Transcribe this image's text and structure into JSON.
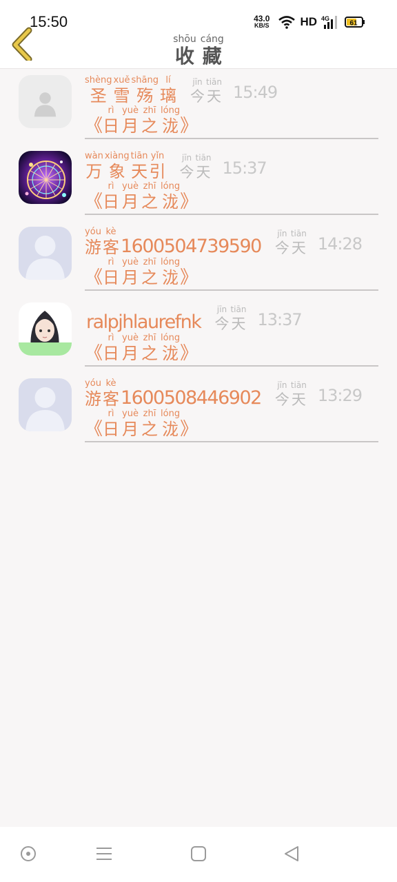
{
  "status": {
    "time": "15:50",
    "net_speed_value": "43.0",
    "net_speed_unit": "KB/S",
    "hd": "HD",
    "network": "4G",
    "battery": "61"
  },
  "header": {
    "title_chars": [
      {
        "py": "shōu",
        "hz": "收"
      },
      {
        "py": "cáng",
        "hz": "藏"
      }
    ]
  },
  "items": [
    {
      "avatar": "default-person-gray",
      "name_chars": [
        {
          "py": "shèng",
          "hz": "圣"
        },
        {
          "py": "xuě",
          "hz": "雪"
        },
        {
          "py": "shāng",
          "hz": "殇"
        },
        {
          "py": "lí",
          "hz": "璃"
        }
      ],
      "name_tail": "",
      "day": [
        {
          "py": "jīn",
          "hz": "今"
        },
        {
          "py": "tiān",
          "hz": "天"
        }
      ],
      "time": "15:49",
      "book_chars": [
        {
          "py": "rì",
          "hz": "日"
        },
        {
          "py": "yuè",
          "hz": "月"
        },
        {
          "py": "zhī",
          "hz": "之"
        },
        {
          "py": "lóng",
          "hz": "泷"
        }
      ]
    },
    {
      "avatar": "ferris-wheel-photo",
      "name_chars": [
        {
          "py": "wàn",
          "hz": "万"
        },
        {
          "py": "xiàng",
          "hz": "象"
        },
        {
          "py": "tiān",
          "hz": "天"
        },
        {
          "py": "yǐn",
          "hz": "引"
        }
      ],
      "name_tail": "",
      "day": [
        {
          "py": "jīn",
          "hz": "今"
        },
        {
          "py": "tiān",
          "hz": "天"
        }
      ],
      "time": "15:37",
      "book_chars": [
        {
          "py": "rì",
          "hz": "日"
        },
        {
          "py": "yuè",
          "hz": "月"
        },
        {
          "py": "zhī",
          "hz": "之"
        },
        {
          "py": "lóng",
          "hz": "泷"
        }
      ]
    },
    {
      "avatar": "default-person-blue",
      "name_chars": [
        {
          "py": "yóu",
          "hz": "游"
        },
        {
          "py": "kè",
          "hz": "客"
        }
      ],
      "name_tail": "1600504739590",
      "day": [
        {
          "py": "jīn",
          "hz": "今"
        },
        {
          "py": "tiān",
          "hz": "天"
        }
      ],
      "time": "14:28",
      "book_chars": [
        {
          "py": "rì",
          "hz": "日"
        },
        {
          "py": "yuè",
          "hz": "月"
        },
        {
          "py": "zhī",
          "hz": "之"
        },
        {
          "py": "lóng",
          "hz": "泷"
        }
      ]
    },
    {
      "avatar": "anime-girl-drawing",
      "name_chars": [],
      "name_tail": "ralpjhlaurefnk",
      "day": [
        {
          "py": "jīn",
          "hz": "今"
        },
        {
          "py": "tiān",
          "hz": "天"
        }
      ],
      "time": "13:37",
      "book_chars": [
        {
          "py": "rì",
          "hz": "日"
        },
        {
          "py": "yuè",
          "hz": "月"
        },
        {
          "py": "zhī",
          "hz": "之"
        },
        {
          "py": "lóng",
          "hz": "泷"
        }
      ]
    },
    {
      "avatar": "default-person-blue",
      "name_chars": [
        {
          "py": "yóu",
          "hz": "游"
        },
        {
          "py": "kè",
          "hz": "客"
        }
      ],
      "name_tail": "1600508446902",
      "day": [
        {
          "py": "jīn",
          "hz": "今"
        },
        {
          "py": "tiān",
          "hz": "天"
        }
      ],
      "time": "13:29",
      "book_chars": [
        {
          "py": "rì",
          "hz": "日"
        },
        {
          "py": "yuè",
          "hz": "月"
        },
        {
          "py": "zhī",
          "hz": "之"
        },
        {
          "py": "lóng",
          "hz": "泷"
        }
      ]
    }
  ],
  "brackets": {
    "open": "《",
    "close": "》"
  },
  "colors": {
    "accent": "#e6895a",
    "back_arrow": "#e8c84a",
    "muted": "#c8c8c8",
    "background": "#f8f6f6"
  },
  "nav": [
    "circle-icon",
    "menu-icon",
    "square-icon",
    "back-triangle-icon"
  ]
}
